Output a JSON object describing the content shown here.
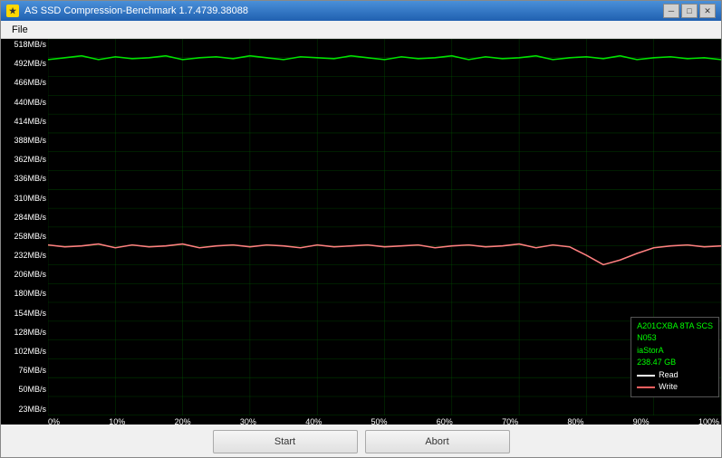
{
  "window": {
    "title": "AS SSD Compression-Benchmark 1.7.4739.38088",
    "icon": "★"
  },
  "titleControls": {
    "minimize": "─",
    "maximize": "□",
    "close": "✕"
  },
  "menu": {
    "file": "File"
  },
  "yAxis": {
    "labels": [
      "518MB/s",
      "492MB/s",
      "466MB/s",
      "440MB/s",
      "414MB/s",
      "388MB/s",
      "362MB/s",
      "336MB/s",
      "310MB/s",
      "284MB/s",
      "258MB/s",
      "232MB/s",
      "206MB/s",
      "180MB/s",
      "154MB/s",
      "128MB/s",
      "102MB/s",
      "76MB/s",
      "50MB/s",
      "23MB/s"
    ]
  },
  "xAxis": {
    "labels": [
      "0%",
      "10%",
      "20%",
      "30%",
      "40%",
      "50%",
      "60%",
      "70%",
      "80%",
      "90%",
      "100%"
    ]
  },
  "legend": {
    "drive": "A201CXBA 8TA SCS",
    "model": "N053",
    "driver": "iaStorA",
    "size": "238.47 GB",
    "readLabel": "Read",
    "writeLabel": "Write"
  },
  "buttons": {
    "start": "Start",
    "abort": "Abort"
  }
}
